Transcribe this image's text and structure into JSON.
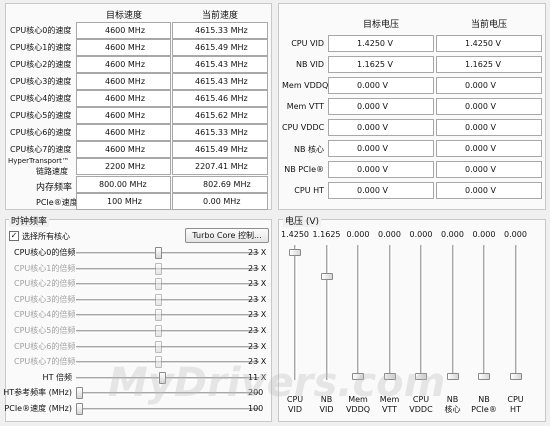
{
  "speed": {
    "headers": {
      "target": "目标速度",
      "current": "当前速度"
    },
    "rows": [
      {
        "label": "CPU核心0的速度",
        "target": "4600 MHz",
        "current": "4615.33 MHz"
      },
      {
        "label": "CPU核心1的速度",
        "target": "4600 MHz",
        "current": "4615.49 MHz"
      },
      {
        "label": "CPU核心2的速度",
        "target": "4600 MHz",
        "current": "4615.43 MHz"
      },
      {
        "label": "CPU核心3的速度",
        "target": "4600 MHz",
        "current": "4615.43 MHz"
      },
      {
        "label": "CPU核心4的速度",
        "target": "4600 MHz",
        "current": "4615.46 MHz"
      },
      {
        "label": "CPU核心5的速度",
        "target": "4600 MHz",
        "current": "4615.62 MHz"
      },
      {
        "label": "CPU核心6的速度",
        "target": "4600 MHz",
        "current": "4615.33 MHz"
      },
      {
        "label": "CPU核心7的速度",
        "target": "4600 MHz",
        "current": "4615.49 MHz"
      }
    ],
    "ht": {
      "label_1": "HyperTransport™",
      "label_2": "链路速度",
      "target": "2200 MHz",
      "current": "2207.41 MHz"
    },
    "memory": {
      "label": "内存频率",
      "target": "800.00 MHz",
      "current": "802.69 MHz"
    },
    "pcie": {
      "label": "PCIe®速度",
      "target": "100 MHz",
      "current": "0.00 MHz"
    }
  },
  "voltage": {
    "headers": {
      "target": "目标电压",
      "current": "当前电压"
    },
    "rows": [
      {
        "label": "CPU VID",
        "target": "1.4250 V",
        "current": "1.4250 V"
      },
      {
        "label": "NB VID",
        "target": "1.1625 V",
        "current": "1.1625 V"
      },
      {
        "label": "Mem VDDQ",
        "target": "0.000 V",
        "current": "0.000 V"
      },
      {
        "label": "Mem VTT",
        "target": "0.000 V",
        "current": "0.000 V"
      },
      {
        "label": "CPU VDDC",
        "target": "0.000 V",
        "current": "0.000 V"
      },
      {
        "label": "NB 核心",
        "target": "0.000 V",
        "current": "0.000 V"
      },
      {
        "label": "NB PCIe®",
        "target": "0.000 V",
        "current": "0.000 V"
      },
      {
        "label": "CPU HT",
        "target": "0.000 V",
        "current": "0.000 V"
      }
    ]
  },
  "clock": {
    "title": "时钟频率",
    "select_all": "选择所有核心",
    "select_all_checked": true,
    "turbo_button": "Turbo Core 控制...",
    "sliders": [
      {
        "label": "CPU核心0的倍频",
        "value": "23 X",
        "level": 0.45,
        "enabled": true
      },
      {
        "label": "CPU核心1的倍频",
        "value": "23 X",
        "level": 0.45,
        "enabled": false
      },
      {
        "label": "CPU核心2的倍频",
        "value": "23 X",
        "level": 0.45,
        "enabled": false
      },
      {
        "label": "CPU核心3的倍频",
        "value": "23 X",
        "level": 0.45,
        "enabled": false
      },
      {
        "label": "CPU核心4的倍频",
        "value": "23 X",
        "level": 0.45,
        "enabled": false
      },
      {
        "label": "CPU核心5的倍频",
        "value": "23 X",
        "level": 0.45,
        "enabled": false
      },
      {
        "label": "CPU核心6的倍频",
        "value": "23 X",
        "level": 0.45,
        "enabled": false
      },
      {
        "label": "CPU核心7的倍频",
        "value": "23 X",
        "level": 0.45,
        "enabled": false
      },
      {
        "label": "HT 倍频",
        "value": "11 X",
        "level": 0.47,
        "enabled": true
      },
      {
        "label": "HT参考频率 (MHz)",
        "value": "200",
        "level": 0.0,
        "enabled": true
      },
      {
        "label": "PCIe®速度 (MHz)",
        "value": "100",
        "level": 0.0,
        "enabled": true
      }
    ]
  },
  "volt_sliders": {
    "title": "电压 (V)",
    "items": [
      {
        "value": "1.4250",
        "name_1": "CPU",
        "name_2": "VID",
        "level": 0.97
      },
      {
        "value": "1.1625",
        "name_1": "NB",
        "name_2": "VID",
        "level": 0.78
      },
      {
        "value": "0.000",
        "name_1": "Mem",
        "name_2": "VDDQ",
        "level": 0.0
      },
      {
        "value": "0.000",
        "name_1": "Mem",
        "name_2": "VTT",
        "level": 0.0
      },
      {
        "value": "0.000",
        "name_1": "CPU",
        "name_2": "VDDC",
        "level": 0.0
      },
      {
        "value": "0.000",
        "name_1": "NB",
        "name_2": "核心",
        "level": 0.0
      },
      {
        "value": "0.000",
        "name_1": "NB",
        "name_2": "PCIe®",
        "level": 0.0
      },
      {
        "value": "0.000",
        "name_1": "CPU",
        "name_2": "HT",
        "level": 0.0
      }
    ]
  },
  "watermark": "MyDrivers.com"
}
